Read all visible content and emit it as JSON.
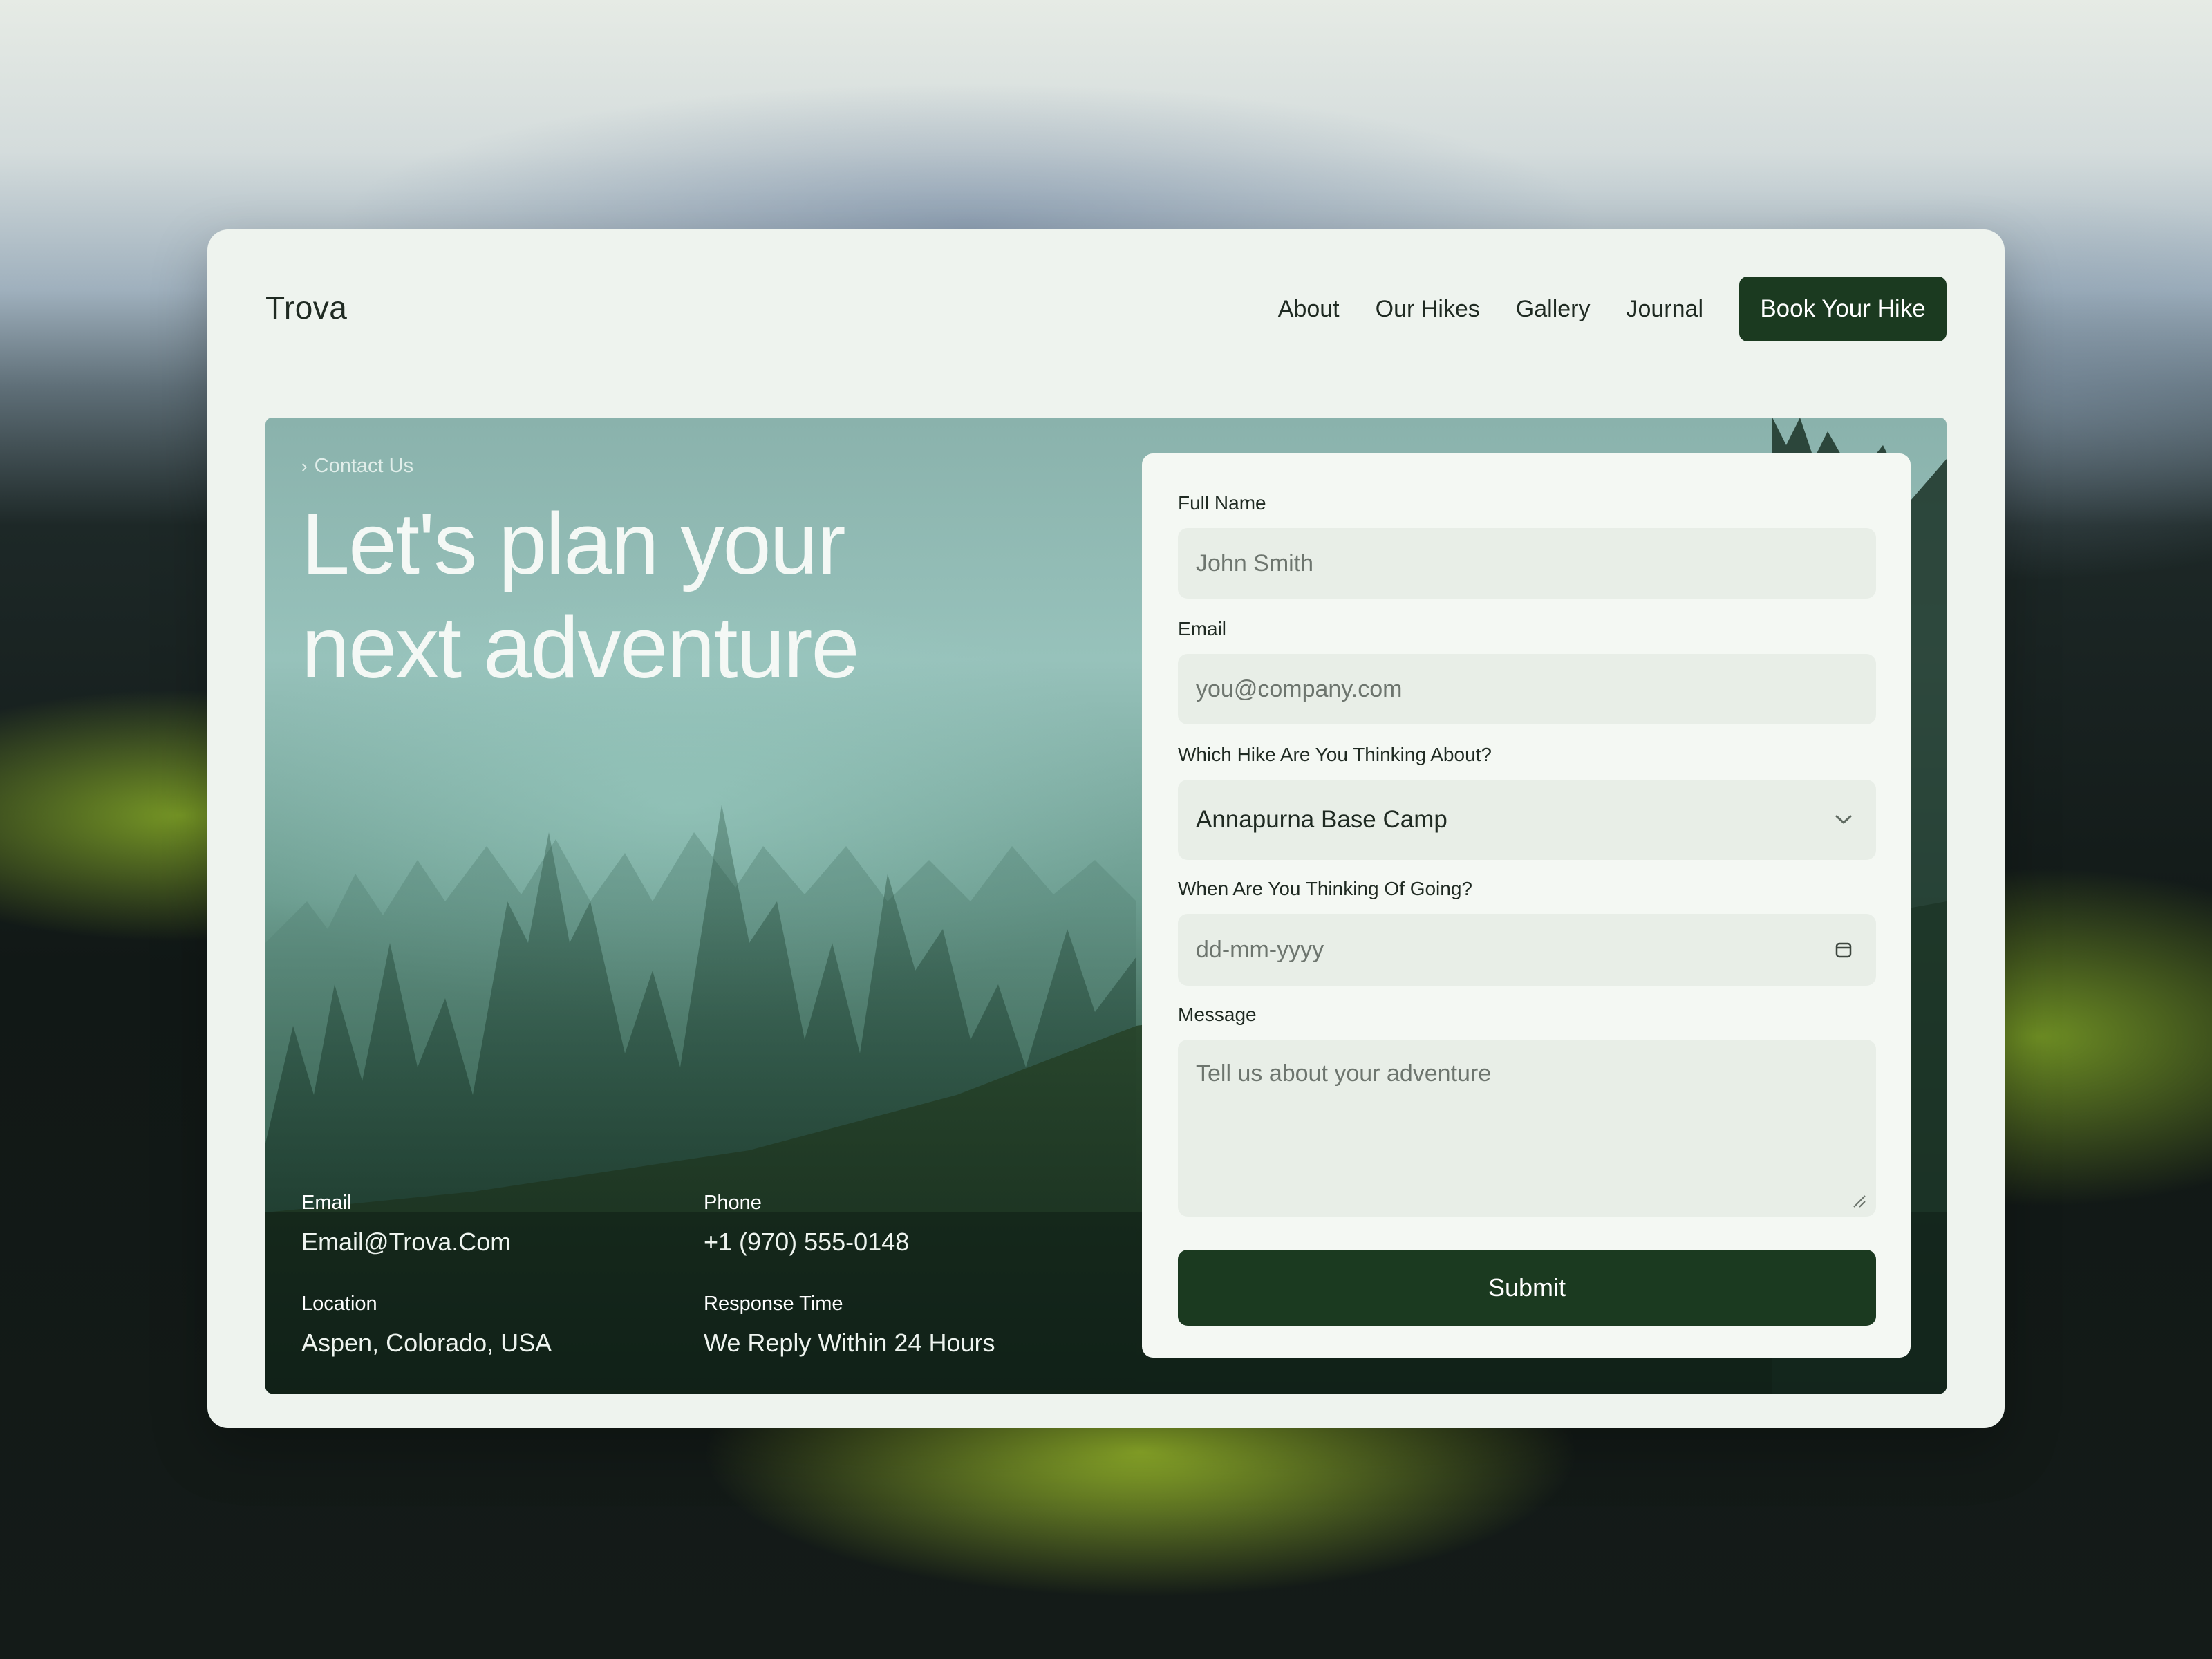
{
  "brand": {
    "name": "Trova"
  },
  "nav": {
    "links": [
      "About",
      "Our Hikes",
      "Gallery",
      "Journal"
    ],
    "cta": "Book Your Hike"
  },
  "hero": {
    "breadcrumb": "Contact Us",
    "headline_line1": "Let's plan your",
    "headline_line2": "next adventure",
    "contact": {
      "email_label": "Email",
      "email_value": "Email@Trova.Com",
      "phone_label": "Phone",
      "phone_value": "+1 (970) 555-0148",
      "location_label": "Location",
      "location_value": "Aspen, Colorado, USA",
      "response_label": "Response Time",
      "response_value": "We Reply Within 24 Hours"
    }
  },
  "form": {
    "full_name_label": "Full Name",
    "full_name_placeholder": "John Smith",
    "email_label": "Email",
    "email_placeholder": "you@company.com",
    "hike_label": "Which Hike Are You Thinking About?",
    "hike_selected": "Annapurna Base Camp",
    "date_label": "When Are You Thinking Of Going?",
    "date_placeholder": "dd-mm-yyyy",
    "message_label": "Message",
    "message_placeholder": "Tell us about your adventure",
    "submit_label": "Submit"
  },
  "icons": {
    "breadcrumb": "chevron-right-icon",
    "select": "chevron-down-icon",
    "date": "calendar-icon",
    "textarea": "resize-handle-icon"
  }
}
